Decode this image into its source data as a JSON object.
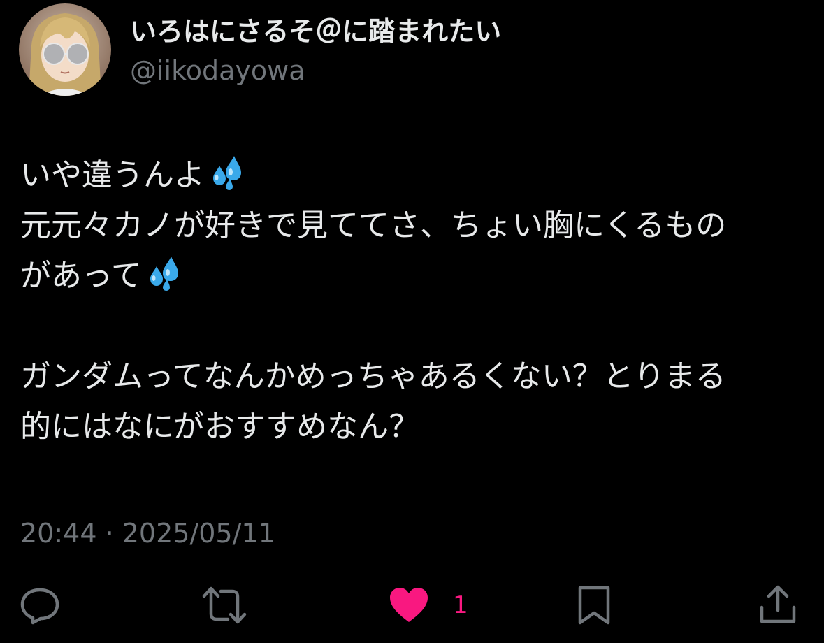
{
  "author": {
    "display_name": "いろはにさるそ＠に踏まれたい",
    "handle": "@iikodayowa",
    "avatar_icon": "anime-girl-avatar"
  },
  "tweet": {
    "lines": [
      "いや違うんよ",
      "元元々カノが好きで見ててさ、ちょい胸にくるもの",
      "があって",
      "",
      "ガンダムってなんかめっちゃあるくない？とりまる",
      "的にはなにがおすすめなん？"
    ],
    "emoji_icon": "sweat-droplets-emoji"
  },
  "timestamp": "20:44 · 2025/05/11",
  "actions": {
    "reply_icon": "reply-icon",
    "retweet_icon": "retweet-icon",
    "like_icon": "heart-icon",
    "like_count": "1",
    "bookmark_icon": "bookmark-icon",
    "share_icon": "share-icon"
  },
  "colors": {
    "background": "#000000",
    "text": "#e7e9ea",
    "secondary": "#71767b",
    "like": "#f91880",
    "emoji": "#3aa9ea"
  }
}
